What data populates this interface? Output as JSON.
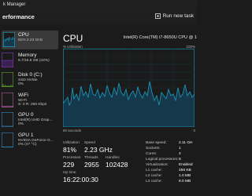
{
  "window": {
    "title": "k Manager"
  },
  "header": {
    "section": "erformance",
    "run_task": "Run new task"
  },
  "sidebar": {
    "items": [
      {
        "label": "CPU",
        "sub": "81% 2.23 GHz",
        "color": "#1aa0c8"
      },
      {
        "label": "Memory",
        "sub": "6.7/15.8 GB (42%)",
        "color": "#8b3fcb"
      },
      {
        "label": "Disk 0 (C:)",
        "sub": "SSD NVMe\n0%",
        "color": "#5fa22c"
      },
      {
        "label": "WiFi",
        "sub": "Wi-Fi\nS: 0 R: 256 Kbps",
        "color": "#b0609d"
      },
      {
        "label": "GPU 0",
        "sub": "Intel(R) UHD Grap...\n0%",
        "color": "#2f89c2"
      },
      {
        "label": "GPU 1",
        "sub": "NVIDIA GeForce G...\n0% (47 °C)",
        "color": "#2f89c2"
      }
    ]
  },
  "main": {
    "title": "CPU",
    "model": "Intel(R) Core(TM) i7-8650U CPU @ 1",
    "util_label": "% Utilization",
    "util_max": "100%",
    "time_left": "60 seconds",
    "time_right": "0",
    "graph_color": "#1a9ec4",
    "graph_fill": "#15394a",
    "stats": {
      "utilization_label": "Utilization",
      "utilization": "81%",
      "speed_label": "Speed",
      "speed": "2.23 GHz",
      "processes_label": "Processes",
      "processes": "229",
      "threads_label": "Threads",
      "threads": "2955",
      "handles_label": "Handles",
      "handles": "102428",
      "uptime_label": "Up time",
      "uptime": "16:22:00:30"
    },
    "details": [
      {
        "key": "Base speed:",
        "value": "2.11 GH"
      },
      {
        "key": "Sockets:",
        "value": "1"
      },
      {
        "key": "Cores:",
        "value": "4"
      },
      {
        "key": "Logical processors:",
        "value": "8"
      },
      {
        "key": "Virtualization:",
        "value": "Enabled"
      },
      {
        "key": "L1 cache:",
        "value": "256 KB"
      },
      {
        "key": "L2 cache:",
        "value": "1.0 MB"
      },
      {
        "key": "L3 cache:",
        "value": "8.0 MB"
      }
    ]
  }
}
